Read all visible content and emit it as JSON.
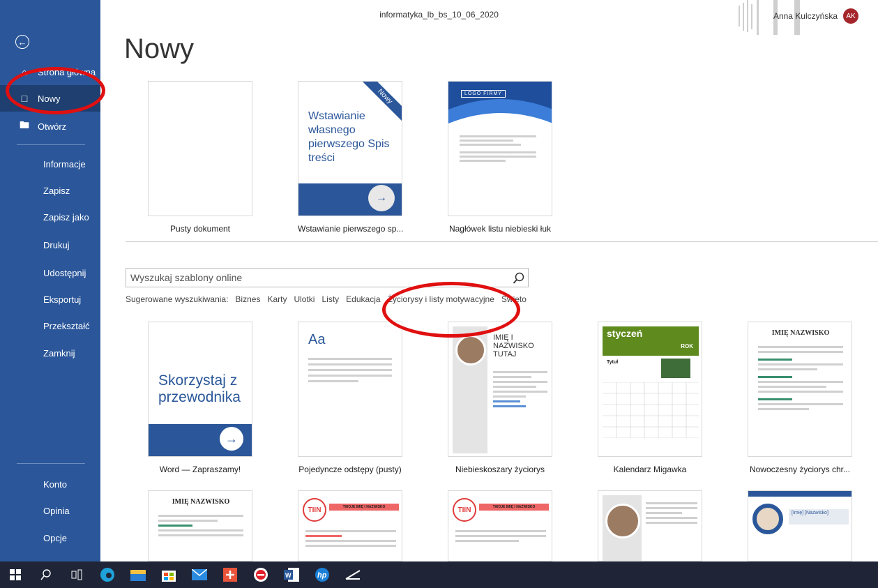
{
  "window": {
    "document_name": "informatyka_lb_bs_10_06_2020",
    "user_name": "Anna Kulczyńska",
    "user_initials": "AK"
  },
  "sidebar": {
    "home": "Strona główna",
    "new": "Nowy",
    "open": "Otwórz",
    "items": [
      "Informacje",
      "Zapisz",
      "Zapisz jako",
      "Drukuj",
      "Udostępnij",
      "Eksportuj",
      "Przekształć",
      "Zamknij"
    ],
    "bottom": [
      "Konto",
      "Opinia",
      "Opcje"
    ]
  },
  "page_title": "Nowy",
  "top_templates": [
    {
      "caption": "Pusty dokument"
    },
    {
      "caption": "Wstawianie pierwszego sp...",
      "thumb_text": "Wstawianie własnego pierwszego Spis treści",
      "badge": "Nowy"
    },
    {
      "caption": "Nagłówek listu niebieski łuk",
      "thumb_text": "LOGO FIRMY"
    }
  ],
  "search": {
    "placeholder": "Wyszukaj szablony online"
  },
  "suggestions": {
    "label": "Sugerowane wyszukiwania:",
    "items": [
      "Biznes",
      "Karty",
      "Ulotki",
      "Listy",
      "Edukacja",
      "Życiorysy i listy motywacyjne",
      "Święto"
    ]
  },
  "templates": [
    {
      "caption": "Word — Zapraszamy!",
      "thumb_text": "Skorzystaj z przewodnika"
    },
    {
      "caption": "Pojedyncze odstępy (pusty)",
      "thumb_text": "Aa"
    },
    {
      "caption": "Niebieskoszary życiorys",
      "thumb_text": "IMIĘ I NAZWISKO TUTAJ"
    },
    {
      "caption": "Kalendarz Migawka",
      "thumb_text": "styczeń",
      "thumb_sub": "ROK",
      "thumb_label": "Tytuł"
    },
    {
      "caption": "Nowoczesny życiorys chr...",
      "thumb_text": "IMIĘ NAZWISKO"
    }
  ],
  "templates_row3": [
    {
      "thumb_text": "IMIĘ NAZWISKO"
    },
    {
      "thumb_text": "TIIN",
      "thumb_sub": "TWOJE IMIĘ I NAZWISKO"
    },
    {
      "thumb_text": "TIIN",
      "thumb_sub": "TWOJE IMIĘ I NAZWISKO"
    },
    {
      "thumb_text": ""
    },
    {
      "thumb_text": "[Imię] [Nazwisko]"
    }
  ],
  "colors": {
    "sidebar": "#2b579a",
    "active": "#1e3f6f",
    "accent_red": "#e01010",
    "taskbar": "#1f2537"
  }
}
